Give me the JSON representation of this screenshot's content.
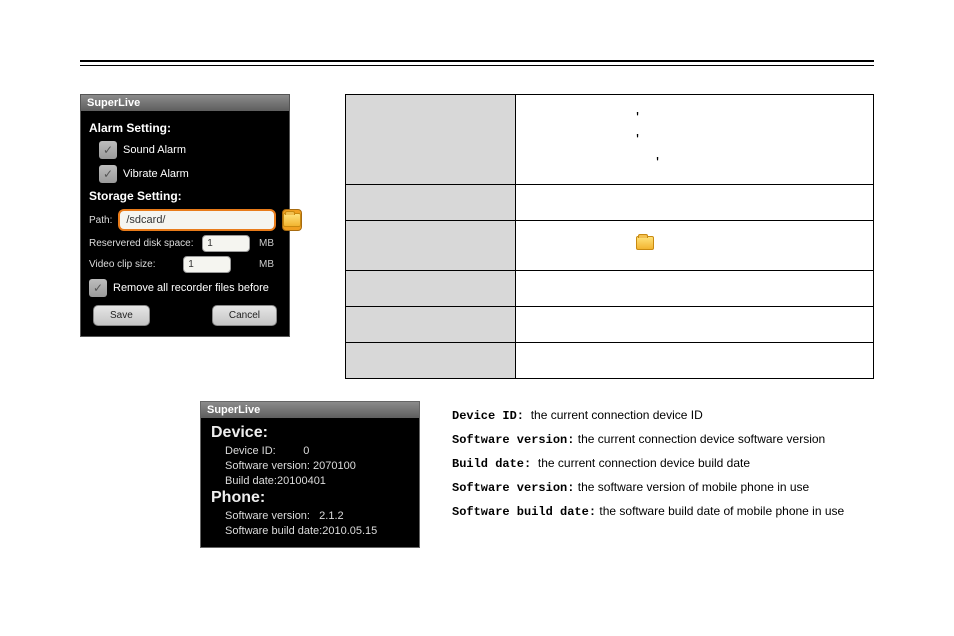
{
  "settings_panel": {
    "title": "SuperLive",
    "alarm_heading": "Alarm Setting:",
    "sound_alarm_label": "Sound Alarm",
    "vibrate_alarm_label": "Vibrate Alarm",
    "storage_heading": "Storage Setting:",
    "path_label": "Path:",
    "path_value": "/sdcard/",
    "reserved_label": "Reservered disk space:",
    "reserved_value": "1",
    "reserved_unit": "MB",
    "clip_label": "Video clip size:",
    "clip_value": "1",
    "clip_unit": "MB",
    "remove_label": "Remove all recorder files before",
    "save_label": "Save",
    "cancel_label": "Cancel"
  },
  "table": {
    "row1_c2_a": "'",
    "row1_c2_b": "'",
    "row1_c2_c": "'"
  },
  "info_panel": {
    "title": "SuperLive",
    "device_heading": "Device:",
    "device_id_label": "Device ID:",
    "device_id_value": "0",
    "device_sw_label": "Software version:",
    "device_sw_value": "2070100",
    "device_build_label": "Build date:",
    "device_build_value": "20100401",
    "phone_heading": "Phone:",
    "phone_sw_label": "Software version:",
    "phone_sw_value": "2.1.2",
    "phone_build_label": "Software build date:",
    "phone_build_value": "2010.05.15"
  },
  "defs": {
    "d1_term": "Device ID:",
    "d1_text": "the current connection device ID",
    "d2_term": "Software version:",
    "d2_text": "the current connection device software version",
    "d3_term": "Build date:",
    "d3_text": "the current connection device build date",
    "d4_term": "Software version:",
    "d4_text": "the  software version of mobile phone in use",
    "d5_term": "Software build date:",
    "d5_text": "the software build date of  mobile phone in use"
  }
}
